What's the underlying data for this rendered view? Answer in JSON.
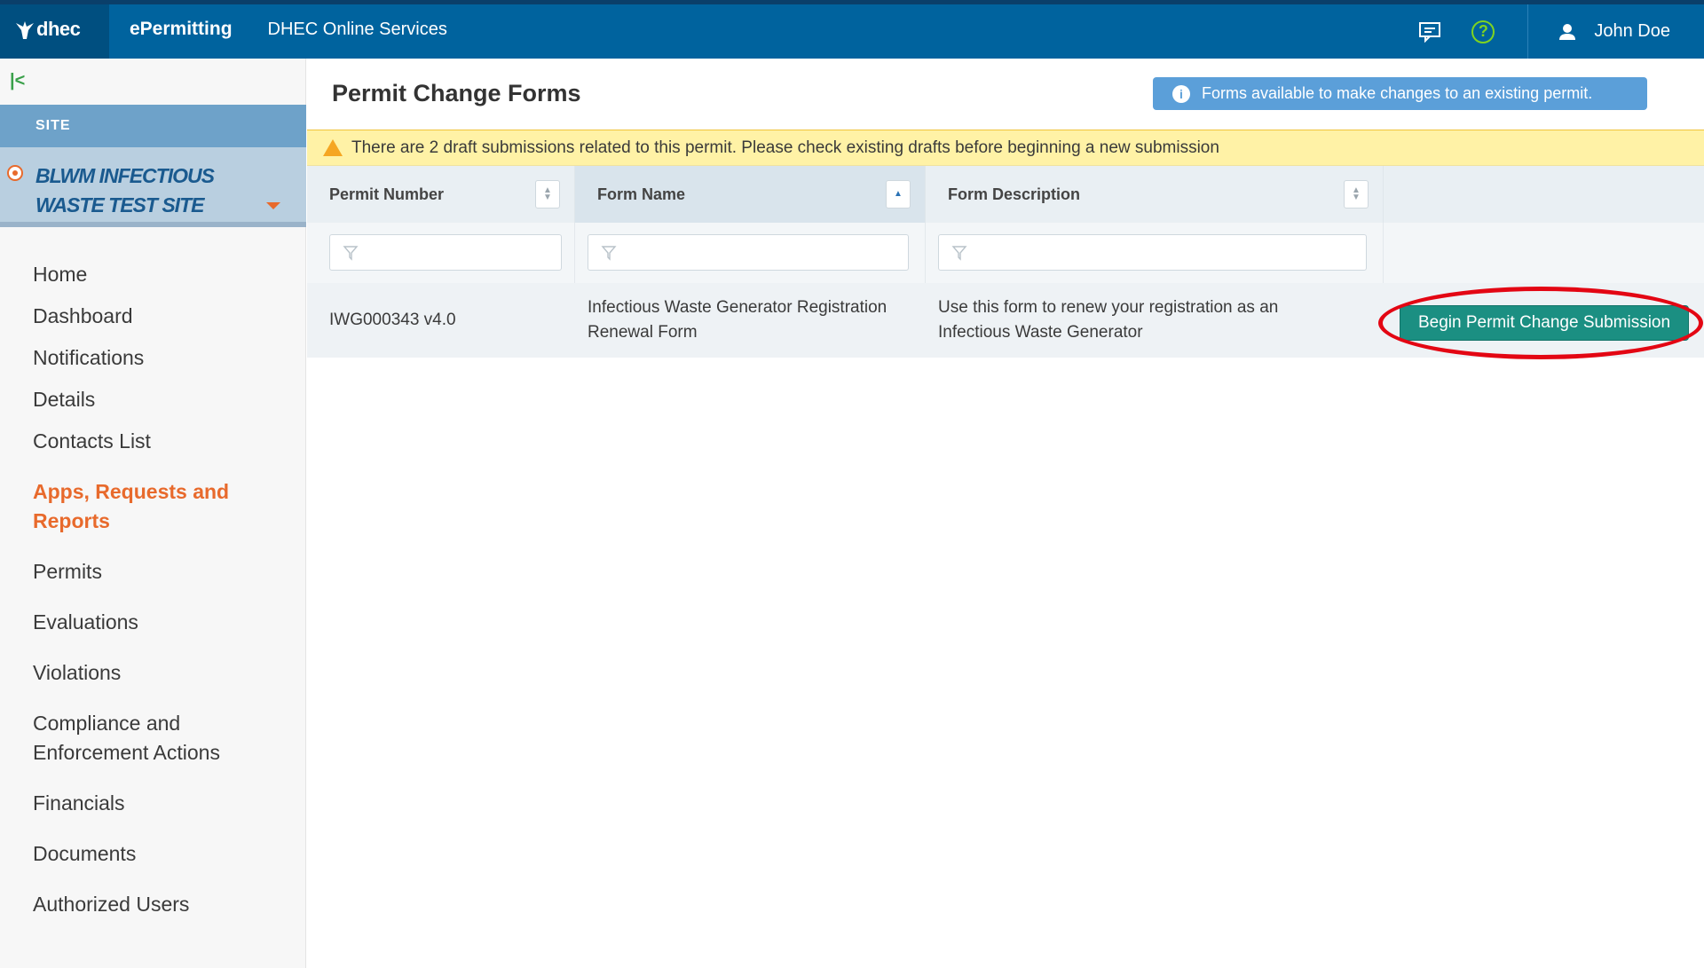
{
  "header": {
    "logo_text": "dhec",
    "app_name": "ePermitting",
    "app_subtitle": "DHEC Online Services",
    "user_name": "John Doe",
    "help_glyph": "?",
    "colors": {
      "bar": "#00639e",
      "help": "#7ed321"
    }
  },
  "sidebar": {
    "collapse_glyph": "|<",
    "site_label": "SITE",
    "site_name": "BLWM INFECTIOUS WASTE TEST SITE",
    "items": [
      {
        "label": "Home"
      },
      {
        "label": "Dashboard"
      },
      {
        "label": "Notifications"
      },
      {
        "label": "Details"
      },
      {
        "label": "Contacts List"
      },
      {
        "label": "Apps, Requests and Reports",
        "active": true
      },
      {
        "label": "Permits"
      },
      {
        "label": "Evaluations"
      },
      {
        "label": "Violations"
      },
      {
        "label": "Compliance and Enforcement Actions"
      },
      {
        "label": "Financials"
      },
      {
        "label": "Documents"
      },
      {
        "label": "Authorized Users"
      }
    ]
  },
  "main": {
    "title": "Permit Change Forms",
    "info_text": "Forms available to make changes to an existing permit.",
    "warning_text": "There are 2 draft submissions related to this permit. Please check existing drafts before beginning a new submission",
    "table": {
      "columns": [
        "Permit Number",
        "Form Name",
        "Form Description"
      ],
      "sorted_column": "Form Name",
      "rows": [
        {
          "permit_number": "IWG000343 v4.0",
          "form_name": "Infectious Waste Generator Registration Renewal Form",
          "form_description": "Use this form to renew your registration as an Infectious Waste Generator",
          "action_label": "Begin Permit Change Submission"
        }
      ]
    }
  }
}
